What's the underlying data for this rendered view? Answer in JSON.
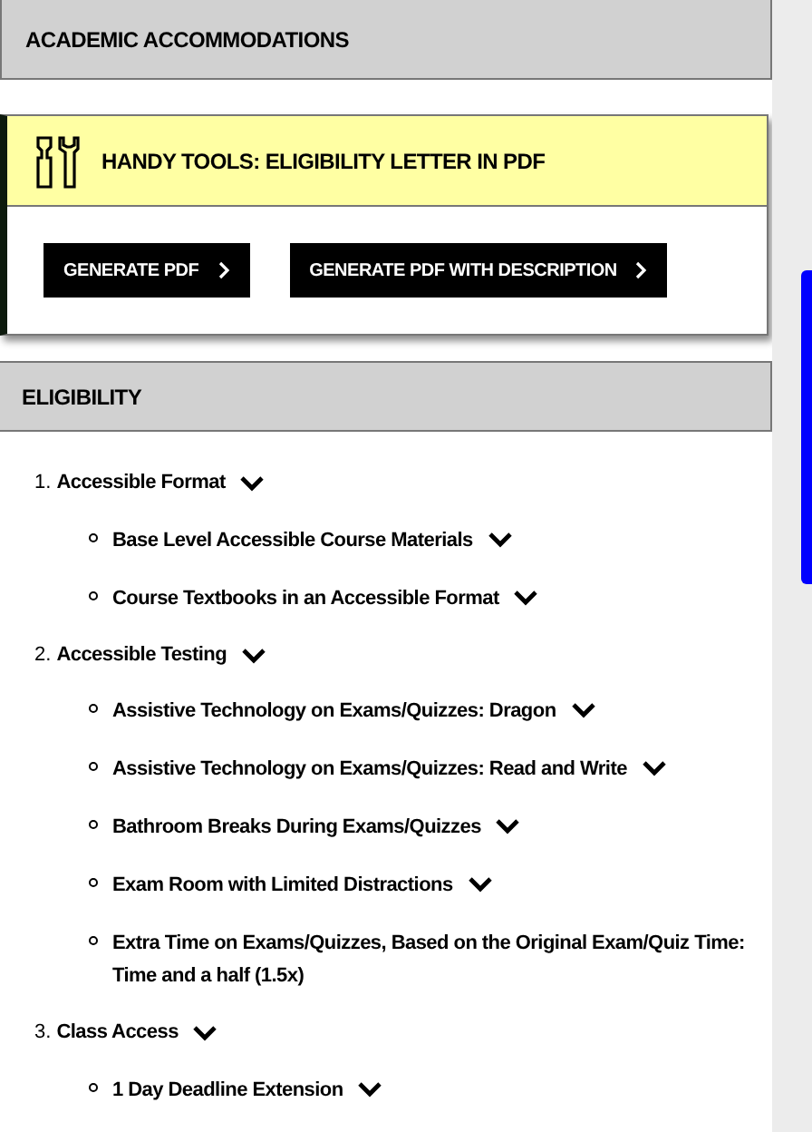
{
  "header": {
    "title": "ACADEMIC ACCOMMODATIONS"
  },
  "tools_card": {
    "title": "HANDY TOOLS: ELIGIBILITY LETTER IN PDF",
    "buttons": [
      {
        "label": "GENERATE PDF"
      },
      {
        "label": "GENERATE PDF WITH DESCRIPTION"
      }
    ]
  },
  "eligibility": {
    "title": "ELIGIBILITY",
    "items": [
      {
        "number": "1.",
        "label": "Accessible Format",
        "expandable": true,
        "children": [
          {
            "label": "Base Level Accessible Course Materials",
            "expandable": true
          },
          {
            "label": "Course Textbooks in an Accessible Format",
            "expandable": true
          }
        ]
      },
      {
        "number": "2.",
        "label": "Accessible Testing",
        "expandable": true,
        "children": [
          {
            "label": "Assistive Technology on Exams/Quizzes: Dragon",
            "expandable": true
          },
          {
            "label": "Assistive Technology on Exams/Quizzes: Read and Write",
            "expandable": true
          },
          {
            "label": "Bathroom Breaks During Exams/Quizzes",
            "expandable": true
          },
          {
            "label": "Exam Room with Limited Distractions",
            "expandable": true
          },
          {
            "label": "Extra Time on Exams/Quizzes, Based on the Original Exam/Quiz Time: Time and a half (1.5x)",
            "expandable": false
          }
        ]
      },
      {
        "number": "3.",
        "label": "Class Access",
        "expandable": true,
        "children": [
          {
            "label": "1 Day Deadline Extension",
            "expandable": true
          }
        ]
      }
    ]
  }
}
